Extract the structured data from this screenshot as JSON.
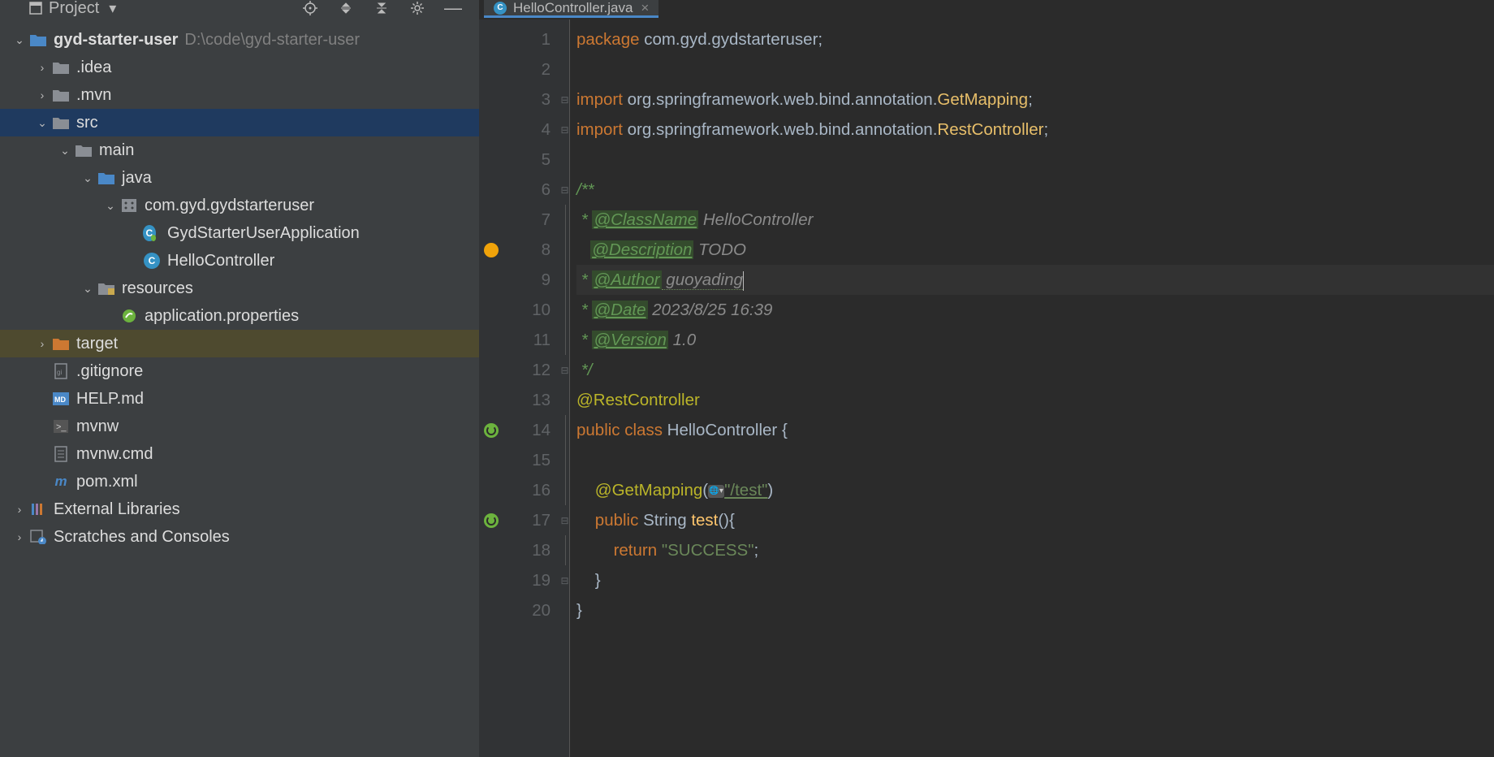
{
  "sidebar": {
    "title": "Project",
    "root": {
      "name": "gyd-starter-user",
      "path": "D:\\code\\gyd-starter-user"
    },
    "tree": {
      "idea": ".idea",
      "mvn": ".mvn",
      "src": "src",
      "main": "main",
      "java": "java",
      "package": "com.gyd.gydstarteruser",
      "app": "GydStarterUserApplication",
      "controller": "HelloController",
      "resources": "resources",
      "appprops": "application.properties",
      "target": "target",
      "gitignore": ".gitignore",
      "help": "HELP.md",
      "mvnw": "mvnw",
      "mvnwcmd": "mvnw.cmd",
      "pom": "pom.xml",
      "extlib": "External Libraries",
      "scratch": "Scratches and Consoles"
    }
  },
  "tab": {
    "name": "HelloController.java"
  },
  "code": {
    "l1": {
      "kw": "package ",
      "rest": "com.gyd.gydstarteruser;"
    },
    "l3": {
      "kw": "import ",
      "p": "org.springframework.web.bind.annotation.",
      "c": "GetMapping",
      "e": ";"
    },
    "l4": {
      "kw": "import ",
      "p": "org.springframework.web.bind.annotation.",
      "c": "RestController",
      "e": ";"
    },
    "l6": "/**",
    "l7": {
      "s": " * ",
      "t": "@ClassName",
      "v": " HelloController"
    },
    "l8": {
      "s": "   ",
      "t": "@Description",
      "v": " TODO"
    },
    "l9": {
      "s": " * ",
      "t": "@Author",
      "v": " guoyading"
    },
    "l10": {
      "s": " * ",
      "t": "@Date",
      "v": " 2023/8/25 16:39"
    },
    "l11": {
      "s": " * ",
      "t": "@Version",
      "v": " 1.0"
    },
    "l12": " */",
    "l13": "@RestController",
    "l14": {
      "a": "public class ",
      "b": "HelloController {"
    },
    "l16": {
      "a": "    ",
      "b": "@GetMapping",
      "c": "(",
      "url": "\"/test\"",
      "d": ")"
    },
    "l17": {
      "a": "    ",
      "b": "public ",
      "c": "String ",
      "d": "test",
      "e": "(){"
    },
    "l18": {
      "a": "        ",
      "b": "return ",
      "c": "\"SUCCESS\"",
      "d": ";"
    },
    "l19": "    }",
    "l20": "}"
  },
  "lines": [
    "1",
    "2",
    "3",
    "4",
    "5",
    "6",
    "7",
    "8",
    "9",
    "10",
    "11",
    "12",
    "13",
    "14",
    "15",
    "16",
    "17",
    "18",
    "19",
    "20"
  ]
}
